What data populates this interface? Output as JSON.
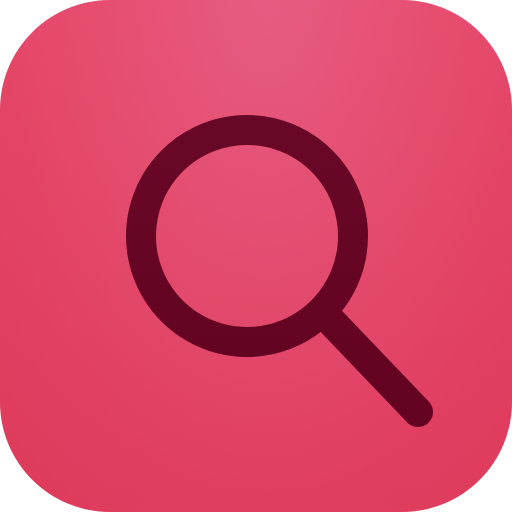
{
  "app_icon": {
    "icon": "search-icon",
    "background_color": "#e54a6e",
    "glyph_color": "#640020"
  }
}
